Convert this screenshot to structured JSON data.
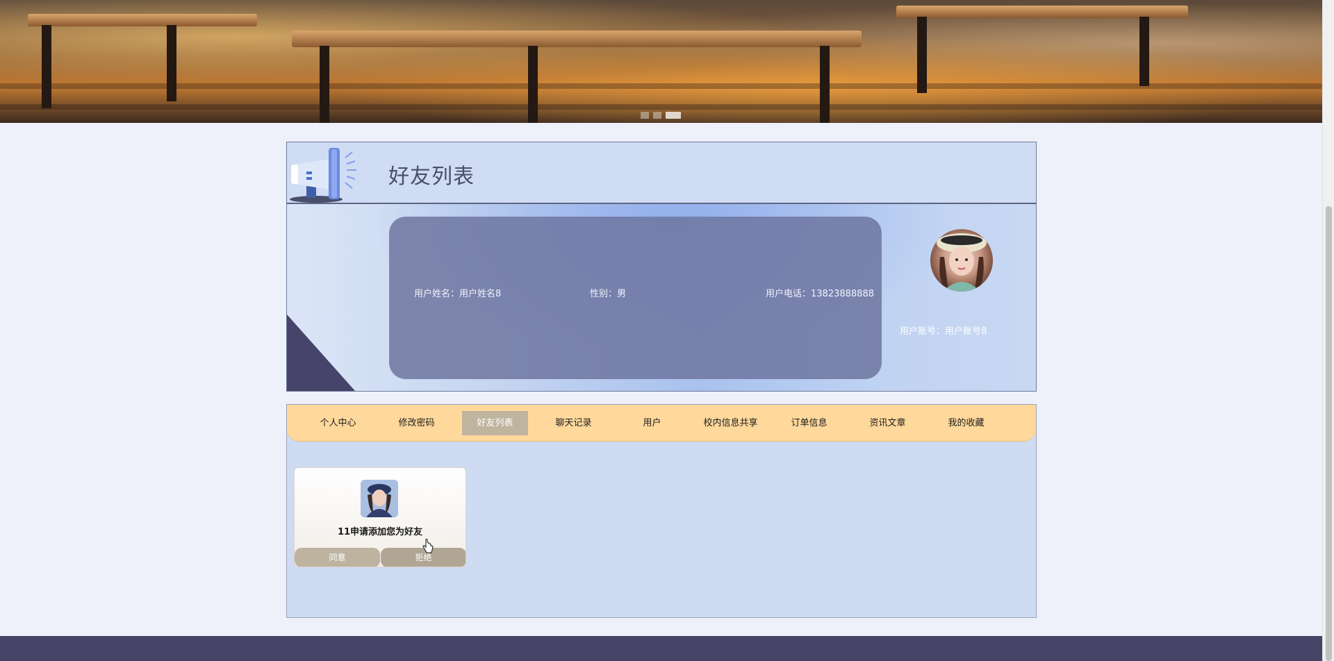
{
  "banner": {
    "slides": 3,
    "active_slide": 3
  },
  "header": {
    "title": "好友列表",
    "icon": "megaphone-icon"
  },
  "profile": {
    "name_label": "用户姓名：",
    "name_value": "用户姓名8",
    "gender_label": "性别：",
    "gender_value": "男",
    "phone_label": "用户电话：",
    "phone_value": "13823888888",
    "account_label": "用户账号：",
    "account_value": "用户账号8"
  },
  "tabs": [
    {
      "label": "个人中心"
    },
    {
      "label": "修改密码"
    },
    {
      "label": "好友列表",
      "active": true
    },
    {
      "label": "聊天记录"
    },
    {
      "label": "用户"
    },
    {
      "label": "校内信息共享"
    },
    {
      "label": "订单信息"
    },
    {
      "label": "资讯文章"
    },
    {
      "label": "我的收藏"
    }
  ],
  "friend_request": {
    "text": "11申请添加您为好友",
    "agree_label": "同意",
    "refuse_label": "拒绝"
  },
  "colors": {
    "tab_bar": "#ffd89b",
    "tab_active": "#bfb49e",
    "card": "#6e76a0",
    "footer": "#464466"
  }
}
